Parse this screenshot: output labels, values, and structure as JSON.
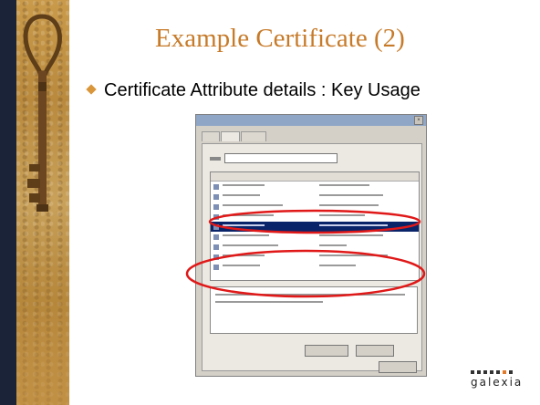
{
  "slide": {
    "title": "Example Certificate (2)",
    "bullet": "Certificate Attribute details : Key Usage"
  },
  "brand": {
    "text": "galexia"
  },
  "colors": {
    "title": "#c77b2a",
    "bullet": "#d9963a",
    "highlight_oval": "#e01818",
    "sideband": "#1b2338"
  },
  "icons": {
    "bullet": "diamond-bullet-icon",
    "sidebar": "key-icon"
  }
}
